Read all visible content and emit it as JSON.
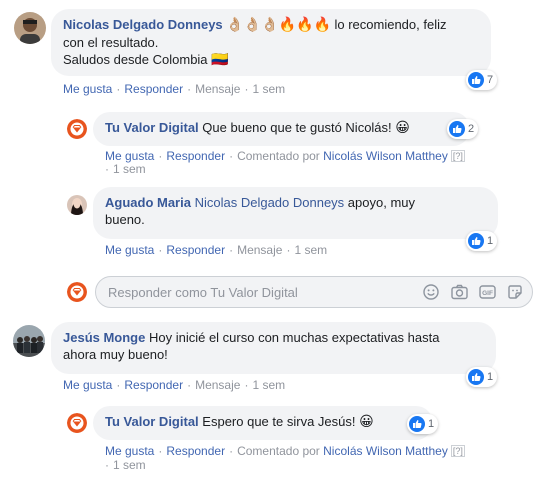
{
  "comments": [
    {
      "author": "Nicolas Delgado Donneys",
      "text_line1_after_emojis": " lo recomiendo, feliz",
      "emojis_hands": "👌🏼👌🏼👌🏼",
      "emojis_fire": "🔥🔥🔥",
      "text_line2": "con el resultado.",
      "text_line3": "Saludos desde Colombia",
      "flag_emoji": "🇨🇴",
      "reactions": "7",
      "actions": {
        "like": "Me gusta",
        "reply": "Responder",
        "message": "Mensaje",
        "time": "1 sem"
      }
    },
    {
      "author": "Tu Valor Digital",
      "text": "Que bueno que te gustó Nicolás!",
      "emoji": "😀",
      "reactions": "2",
      "actions": {
        "like": "Me gusta",
        "reply": "Responder",
        "commented_by": "Comentado por",
        "commenter": "Nicolás Wilson Matthey",
        "badge": "[?]",
        "time": "1 sem"
      }
    },
    {
      "author": "Aguado Maria",
      "mention": "Nicolas Delgado Donneys",
      "text_line1": " apoyo, muy",
      "text_line2": "bueno.",
      "reactions": "1",
      "actions": {
        "like": "Me gusta",
        "reply": "Responder",
        "message": "Mensaje",
        "time": "1 sem"
      }
    },
    {
      "author": "Jesús Monge",
      "text_line1": "Hoy inicié el curso con muchas expectativas hasta",
      "text_line2": "ahora muy bueno!",
      "reactions": "1",
      "actions": {
        "like": "Me gusta",
        "reply": "Responder",
        "message": "Mensaje",
        "time": "1 sem"
      }
    },
    {
      "author": "Tu Valor Digital",
      "text": "Espero que te sirva Jesús!",
      "emoji": "😀",
      "reactions": "1",
      "actions": {
        "like": "Me gusta",
        "reply": "Responder",
        "commented_by": "Comentado por",
        "commenter": "Nicolás Wilson Matthey",
        "badge": "[?]",
        "time": "1 sem"
      }
    }
  ],
  "reply_box": {
    "placeholder": "Responder como Tu Valor Digital"
  },
  "icons": [
    "smiley-icon",
    "camera-icon",
    "gif-icon",
    "sticker-icon",
    "like-icon",
    "brand-logo-icon"
  ],
  "colors": {
    "name_blue": "#385898",
    "link_blue": "#4267b2",
    "like_blue": "#1877f2",
    "bubble_gray": "#f2f3f5",
    "meta_gray": "#90949c",
    "brand_orange": "#e8541e"
  }
}
